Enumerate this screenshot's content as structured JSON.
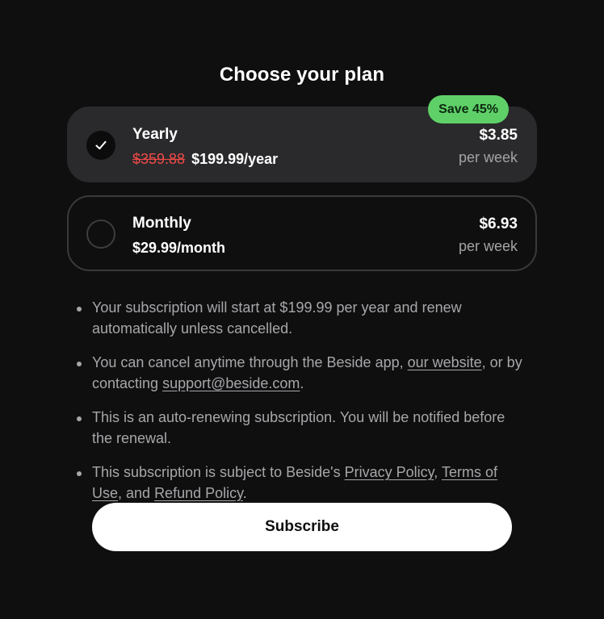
{
  "header": {
    "title": "Choose your plan"
  },
  "plans": [
    {
      "name": "Yearly",
      "selected": true,
      "badge": "Save 45%",
      "old_price": "$359.88",
      "price": "$199.99/year",
      "weekly_price": "$3.85",
      "weekly_unit": "per week"
    },
    {
      "name": "Monthly",
      "selected": false,
      "price": "$29.99/month",
      "weekly_price": "$6.93",
      "weekly_unit": "per week"
    }
  ],
  "terms": {
    "item1": "Your subscription will start at $199.99 per year and renew automatically unless cancelled.",
    "item2": {
      "text1": "You can cancel anytime through the Beside app, ",
      "link1": "our website",
      "text2": ", or by contacting ",
      "link2": "support@beside.com",
      "text3": "."
    },
    "item3": "This is an auto-renewing subscription. You will be notified before the renewal.",
    "item4": {
      "text1": "This subscription is subject to Beside's ",
      "link1": "Privacy Policy",
      "text2": ", ",
      "link2": "Terms of Use",
      "text3": ", and ",
      "link3": "Refund Policy",
      "text4": "."
    }
  },
  "actions": {
    "subscribe_label": "Subscribe"
  },
  "icons": {
    "selected_radio": "checkmark-icon",
    "unselected_radio": "empty-radio-icon"
  },
  "colors": {
    "background": "#0f0f10",
    "selected_card": "#2a2a2c",
    "badge": "#5fd068",
    "strike_price": "#ef4a47",
    "muted_text": "#a7a7aa",
    "button": "#ffffff"
  }
}
